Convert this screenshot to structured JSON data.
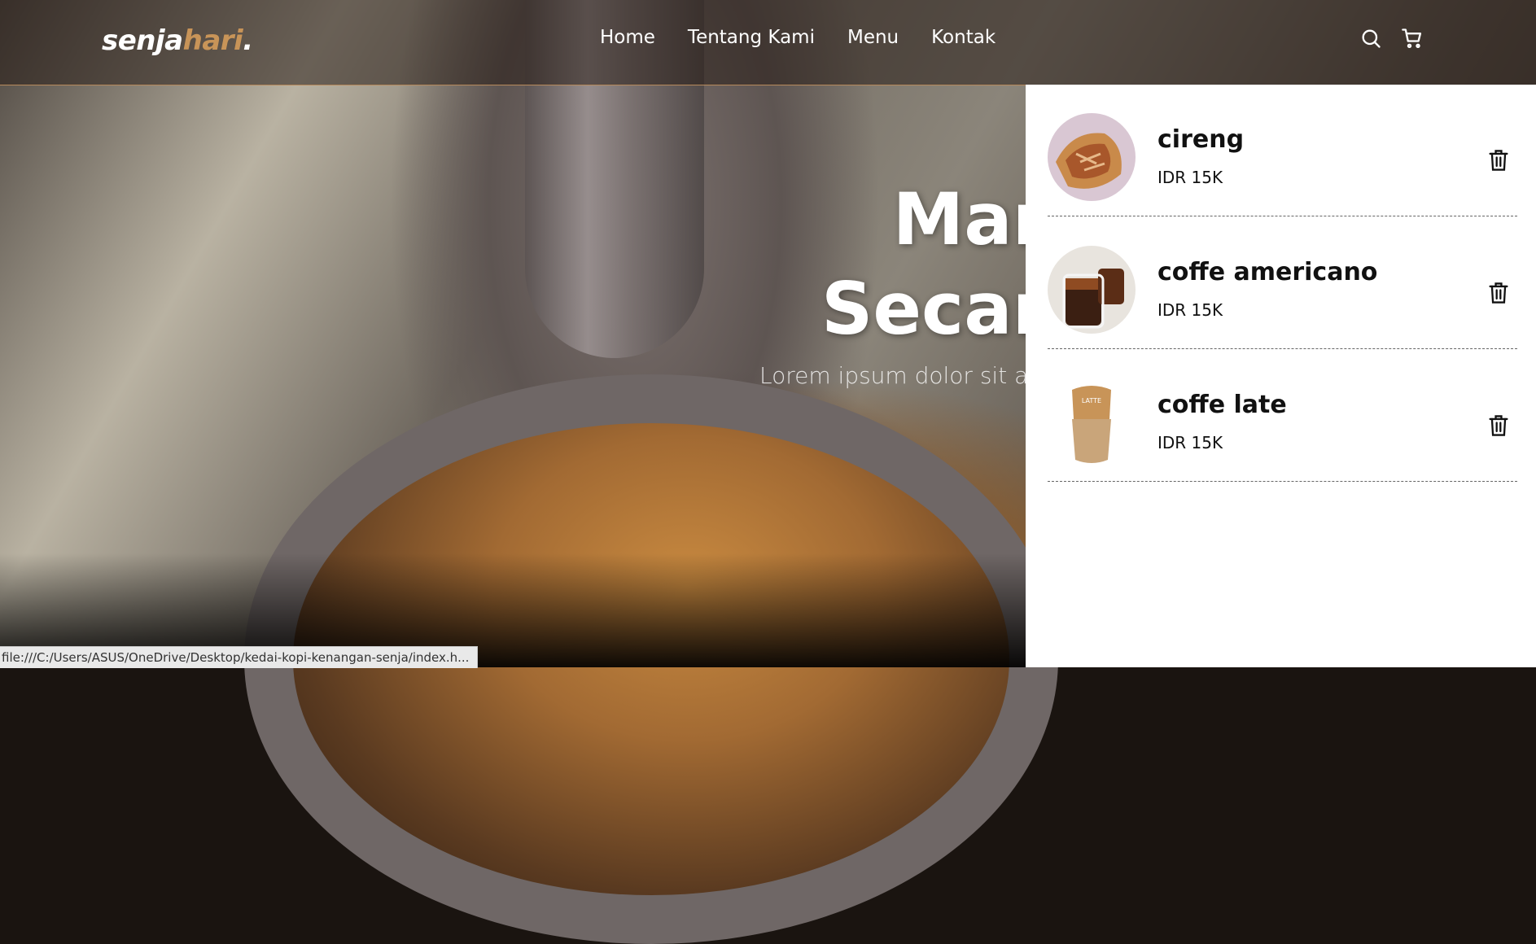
{
  "logo": {
    "main": "senja",
    "accent": "hari",
    "dot": "."
  },
  "nav": {
    "links": [
      "Home",
      "Tentang Kami",
      "Menu",
      "Kontak"
    ],
    "icons": [
      "search-icon",
      "cart-icon"
    ]
  },
  "hero": {
    "title_line1": "Mar",
    "title_line2": "Secar",
    "subtitle": "Lorem ipsum dolor sit a"
  },
  "cart": {
    "items": [
      {
        "name": "cireng",
        "price": "IDR 15K",
        "icon": "trash-icon"
      },
      {
        "name": "coffe americano",
        "price": "IDR 15K",
        "icon": "trash-icon"
      },
      {
        "name": "coffe late",
        "price": "IDR 15K",
        "icon": "trash-icon"
      }
    ]
  },
  "statusbar": {
    "url": "file:///C:/Users/ASUS/OneDrive/Desktop/kedai-kopi-kenangan-senja/index.h..."
  },
  "colors": {
    "accent": "#c89458",
    "panel": "#ffffff",
    "text": "#111111"
  }
}
